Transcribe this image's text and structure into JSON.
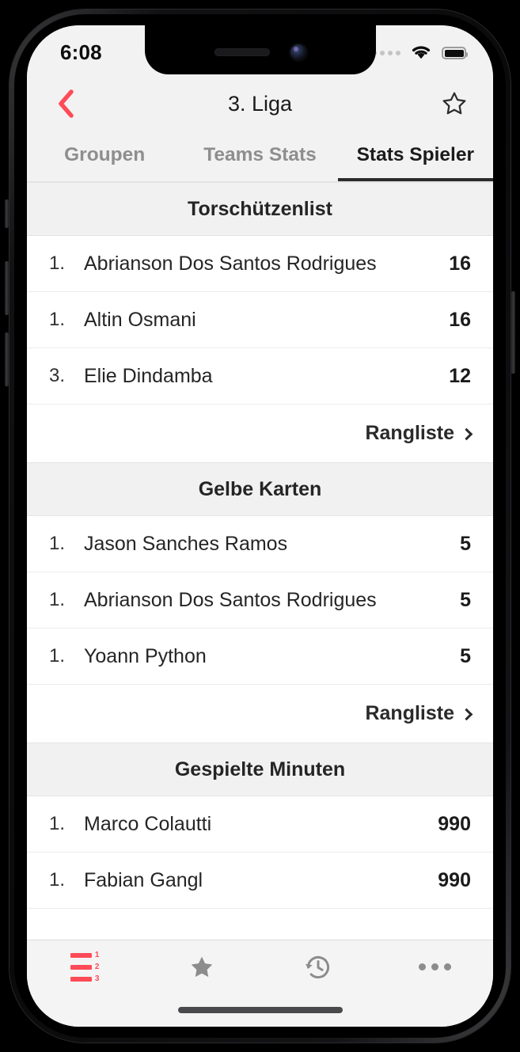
{
  "status_bar": {
    "time": "6:08",
    "signal_icon": "signal-dots-icon",
    "wifi_icon": "wifi-icon",
    "battery_icon": "battery-full-icon"
  },
  "header": {
    "back_icon": "chevron-left-icon",
    "title": "3. Liga",
    "favorite_icon": "star-outline-icon",
    "accent_color": "#ff4b57"
  },
  "tabs": [
    {
      "label": "Groupen",
      "active": false
    },
    {
      "label": "Teams Stats",
      "active": false
    },
    {
      "label": "Stats Spieler",
      "active": true
    }
  ],
  "sections": [
    {
      "title": "Torschützenlist",
      "rows": [
        {
          "rank": "1.",
          "name": "Abrianson Dos Santos Rodrigues",
          "value": "16"
        },
        {
          "rank": "1.",
          "name": "Altin Osmani",
          "value": "16"
        },
        {
          "rank": "3.",
          "name": "Elie Dindamba",
          "value": "12"
        }
      ],
      "more_label": "Rangliste"
    },
    {
      "title": "Gelbe Karten",
      "rows": [
        {
          "rank": "1.",
          "name": "Jason Sanches Ramos",
          "value": "5"
        },
        {
          "rank": "1.",
          "name": "Abrianson Dos Santos Rodrigues",
          "value": "5"
        },
        {
          "rank": "1.",
          "name": "Yoann Python",
          "value": "5"
        }
      ],
      "more_label": "Rangliste"
    },
    {
      "title": "Gespielte Minuten",
      "rows": [
        {
          "rank": "1.",
          "name": "Marco Colautti",
          "value": "990"
        },
        {
          "rank": "1.",
          "name": "Fabian Gangl",
          "value": "990"
        }
      ],
      "more_label": ""
    }
  ],
  "tabbar": [
    {
      "icon": "ranking-list-icon",
      "active": true,
      "numbers": [
        "1",
        "2",
        "3"
      ]
    },
    {
      "icon": "star-filled-icon",
      "active": false
    },
    {
      "icon": "history-clock-icon",
      "active": false
    },
    {
      "icon": "ellipsis-more-icon",
      "active": false
    }
  ]
}
